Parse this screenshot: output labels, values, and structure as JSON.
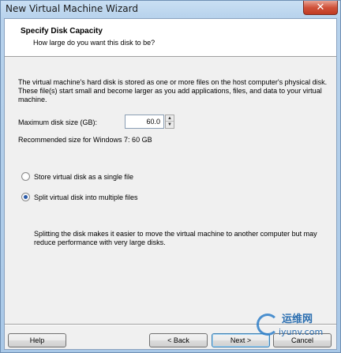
{
  "window": {
    "title": "New Virtual Machine Wizard",
    "close_glyph": "✕"
  },
  "header": {
    "title": "Specify Disk Capacity",
    "subtitle": "How large do you want this disk to be?"
  },
  "body": {
    "description": "The virtual machine's hard disk is stored as one or more files on the host computer's physical disk. These file(s) start small and become larger as you add applications, files, and data to your virtual machine.",
    "disk_size_label": "Maximum disk size (GB):",
    "disk_size_value": "60.0",
    "recommended": "Recommended size for Windows 7: 60 GB",
    "options": [
      {
        "label": "Store virtual disk as a single file",
        "checked": false
      },
      {
        "label": "Split virtual disk into multiple files",
        "checked": true
      }
    ],
    "split_note": "Splitting the disk makes it easier to move the virtual machine to another computer but may reduce performance with very large disks."
  },
  "buttons": {
    "help": "Help",
    "back": "< Back",
    "next": "Next >",
    "cancel": "Cancel"
  },
  "watermark": {
    "top": "运维网",
    "bottom": "iyunv.com"
  },
  "colors": {
    "accent": "#2a5aa8",
    "close": "#c03a22"
  }
}
